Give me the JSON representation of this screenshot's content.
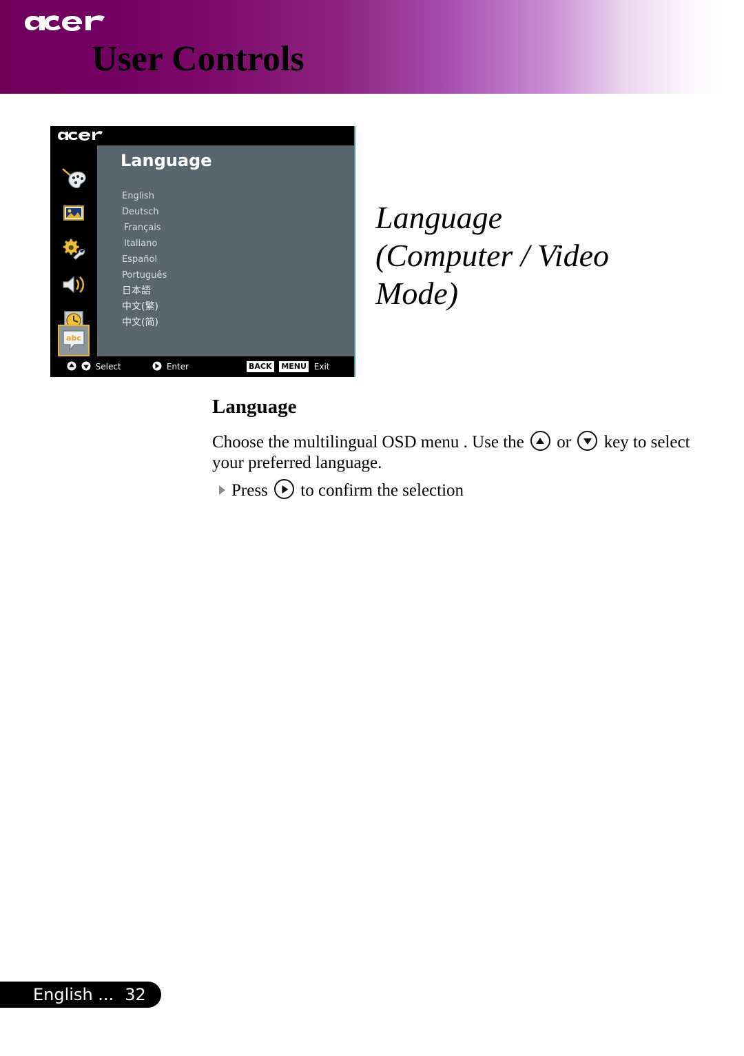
{
  "header": {
    "logo": "acer-logo",
    "title": "User Controls",
    "gradient_start": "#6e005c",
    "gradient_mid": "#a64daf",
    "gradient_end": "#ffffff"
  },
  "osd": {
    "brand": "acer",
    "panel_title": "Language",
    "panel_bg": "#59666d",
    "highlight_color": "#e8b42c",
    "border_color": "#4f9a96",
    "sidebar_icons": [
      {
        "name": "color-palette-icon",
        "label": "Color"
      },
      {
        "name": "image-icon",
        "label": "Image"
      },
      {
        "name": "setup-gear-wrench-icon",
        "label": "Setup"
      },
      {
        "name": "audio-speaker-icon",
        "label": "Audio"
      },
      {
        "name": "timer-clock-icon",
        "label": "Timer"
      }
    ],
    "selected_icon": {
      "name": "language-abc-bubble-icon",
      "label": "abc"
    },
    "languages": [
      "English",
      "Deutsch",
      "Français",
      "Italiano",
      "Español",
      "Português",
      "日本語",
      "中文(繁)",
      "中文(简)"
    ],
    "hints": {
      "select": "Select",
      "enter": "Enter",
      "exit": "Exit",
      "key_back": "BACK",
      "key_menu": "MENU"
    }
  },
  "side_title": {
    "line1": "Language",
    "line2": "(Computer / Video",
    "line3": "Mode)"
  },
  "content": {
    "heading": "Language",
    "paragraph_part1": "Choose the multilingual OSD menu . Use the",
    "paragraph_or": "or",
    "paragraph_part2": "key to select your preferred language.",
    "bullet_part1": "Press",
    "bullet_part2": "to confirm the selection"
  },
  "footer": {
    "language": "English ...",
    "page": "32"
  }
}
